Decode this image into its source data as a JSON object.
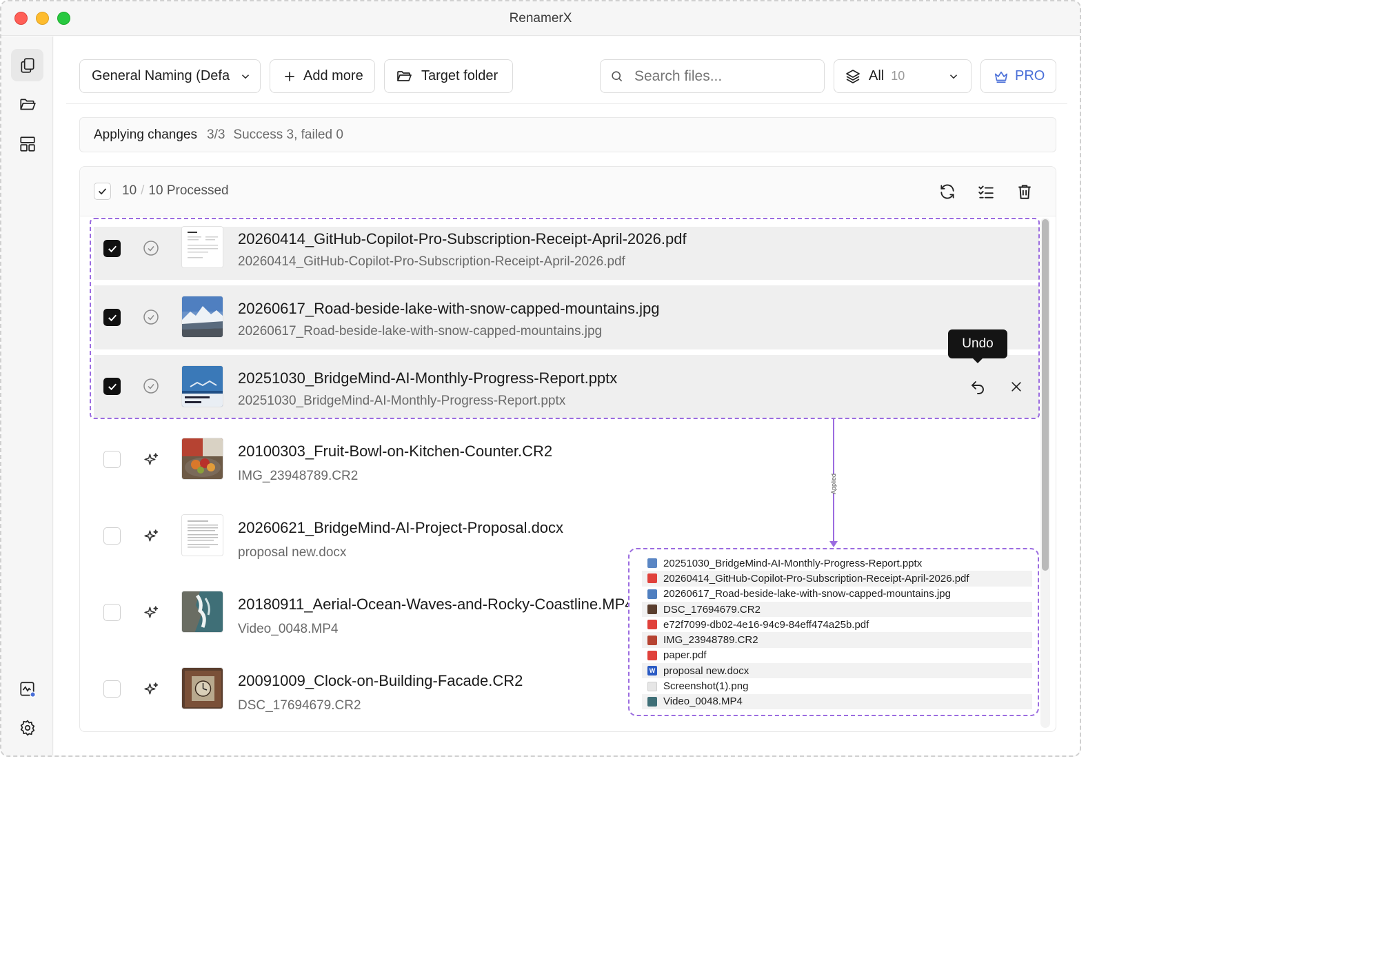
{
  "window": {
    "title": "RenamerX"
  },
  "toolbar": {
    "preset_label": "General Naming (Defa",
    "add_more_label": "Add more",
    "target_folder_label": "Target folder",
    "search_placeholder": "Search files...",
    "filter_label": "All",
    "filter_count": "10",
    "pro_label": "PRO"
  },
  "status": {
    "title": "Applying changes",
    "progress": "3/3",
    "summary": "Success 3, failed 0"
  },
  "list_header": {
    "count": "10",
    "separator": "/",
    "processed": "10 Processed"
  },
  "tooltip": {
    "text": "Undo"
  },
  "rows": [
    {
      "name": "20260414_GitHub-Copilot-Pro-Subscription-Receipt-April-2026.pdf",
      "original": "20260414_GitHub-Copilot-Pro-Subscription-Receipt-April-2026.pdf",
      "checked": true,
      "status": "done",
      "thumb": "pdf-receipt"
    },
    {
      "name": "20260617_Road-beside-lake-with-snow-capped-mountains.jpg",
      "original": "20260617_Road-beside-lake-with-snow-capped-mountains.jpg",
      "checked": true,
      "status": "done",
      "thumb": "mountain"
    },
    {
      "name": "20251030_BridgeMind-AI-Monthly-Progress-Report.pptx",
      "original": "20251030_BridgeMind-AI-Monthly-Progress-Report.pptx",
      "checked": true,
      "status": "done",
      "thumb": "slide"
    },
    {
      "name": "20100303_Fruit-Bowl-on-Kitchen-Counter.CR2",
      "original": "IMG_23948789.CR2",
      "checked": false,
      "status": "ai",
      "thumb": "fruit"
    },
    {
      "name": "20260621_BridgeMind-AI-Project-Proposal.docx",
      "original": "proposal new.docx",
      "checked": false,
      "status": "ai",
      "thumb": "doc"
    },
    {
      "name": "20180911_Aerial-Ocean-Waves-and-Rocky-Coastline.MP4",
      "original": "Video_0048.MP4",
      "checked": false,
      "status": "ai",
      "thumb": "ocean"
    },
    {
      "name": "20091009_Clock-on-Building-Facade.CR2",
      "original": "DSC_17694679.CR2",
      "checked": false,
      "status": "ai",
      "thumb": "clock"
    }
  ],
  "annotation": {
    "label": "Applied"
  },
  "folder_popup": {
    "files": [
      {
        "name": "20251030_BridgeMind-AI-Monthly-Progress-Report.pptx",
        "icon": "pptx-icon"
      },
      {
        "name": "20260414_GitHub-Copilot-Pro-Subscription-Receipt-April-2026.pdf",
        "icon": "pdf-icon"
      },
      {
        "name": "20260617_Road-beside-lake-with-snow-capped-mountains.jpg",
        "icon": "image-icon"
      },
      {
        "name": "DSC_17694679.CR2",
        "icon": "raw-photo-icon"
      },
      {
        "name": "e72f7099-db02-4e16-94c9-84eff474a25b.pdf",
        "icon": "pdf-icon"
      },
      {
        "name": "IMG_23948789.CR2",
        "icon": "raw-photo-icon"
      },
      {
        "name": "paper.pdf",
        "icon": "pdf-icon"
      },
      {
        "name": "proposal new.docx",
        "icon": "docx-icon"
      },
      {
        "name": "Screenshot(1).png",
        "icon": "png-icon"
      },
      {
        "name": "Video_0048.MP4",
        "icon": "video-icon"
      }
    ]
  },
  "colors": {
    "accent": "#9b6ce0",
    "pro": "#4a6fd8"
  }
}
